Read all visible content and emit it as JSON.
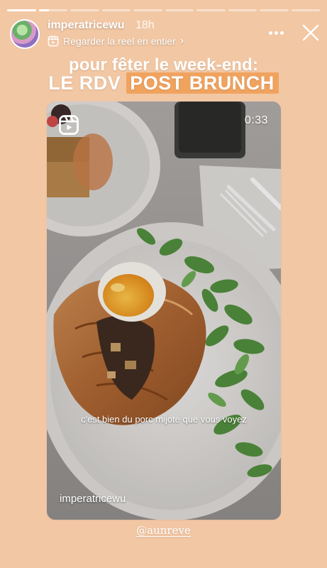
{
  "progress": {
    "segments": 10,
    "current_index": 1,
    "current_fraction": 0.35
  },
  "header": {
    "username": "imperatricewu",
    "time": "18h",
    "reel_link": "Regarder la reel en entier",
    "more_icon": "more-dots-icon",
    "close_icon": "close-icon"
  },
  "headline": {
    "line1": "pour fêter le week-end:",
    "line2_plain": "LE RDV",
    "line2_highlight": "POST BRUNCH",
    "highlight_color": "#f0a35f"
  },
  "reel": {
    "duration": "0:33",
    "caption": "c'est bien du porc mijoté que vous voyez",
    "watermark": "imperatricewu",
    "icon": "reels-icon"
  },
  "mention": "@aunreve",
  "colors": {
    "background": "#f2c7a4",
    "text": "#ffffff"
  }
}
